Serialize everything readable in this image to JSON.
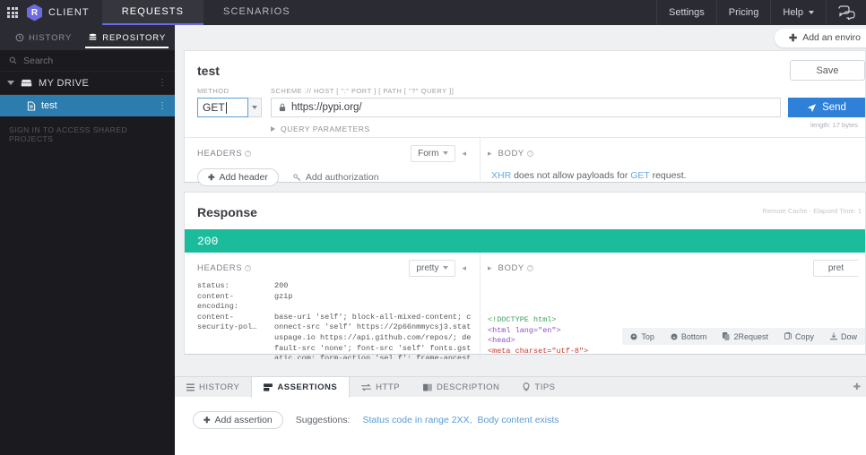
{
  "topbar": {
    "grid_icon": "apps-grid-icon",
    "logo_letter": "R",
    "brand": "CLIENT",
    "tabs": [
      {
        "label": "REQUESTS",
        "active": true
      },
      {
        "label": "SCENARIOS",
        "active": false
      }
    ],
    "right_links": [
      "Settings",
      "Pricing"
    ],
    "help_label": "Help",
    "chat_icon": "chat-bubbles-icon"
  },
  "sidebar": {
    "tabs": [
      {
        "label": "HISTORY",
        "icon": "clock-icon",
        "active": false
      },
      {
        "label": "REPOSITORY",
        "icon": "database-icon",
        "active": true
      }
    ],
    "doc_button_icon": "document-icon",
    "search_placeholder": "Search",
    "search_icon": "search-icon",
    "drive": {
      "label": "MY DRIVE",
      "icon": "drive-icon",
      "expanded": true,
      "menu": "⋮"
    },
    "files": [
      {
        "label": "test",
        "icon": "file-icon",
        "selected": true,
        "menu": "⋮"
      }
    ],
    "signin_note": "SIGN IN TO ACCESS SHARED PROJECTS"
  },
  "main": {
    "env_button": {
      "label": "Add an enviro",
      "icon": "plus-icon"
    },
    "request": {
      "title": "test",
      "save_label": "Save",
      "method_label": "METHOD",
      "method_value": "GET",
      "url_label": "SCHEME :// HOST [ \":\" PORT ] [ PATH [ \"?\" QUERY ]]",
      "url_value": "https://pypi.org/",
      "lock_icon": "lock-icon",
      "send_label": "Send",
      "send_icon": "send-icon",
      "query_params_label": "QUERY PARAMETERS",
      "length_note": "length: 17 bytes",
      "headers": {
        "title": "HEADERS",
        "form_label": "Form",
        "add_header_label": "Add header",
        "add_auth_label": "Add authorization",
        "add_icon": "plus-icon",
        "key_icon": "key-icon"
      },
      "body": {
        "title": "BODY",
        "note_prefix": "XHR",
        "note_mid": " does not allow payloads for ",
        "note_method": "GET",
        "note_suffix": " request."
      }
    },
    "response": {
      "title": "Response",
      "meta": "Remote Cache - Elapsed Time: 1",
      "status_code": "200",
      "status_color": "#1abc9c",
      "headers": {
        "title": "HEADERS",
        "pretty_label": "pretty",
        "rows": [
          {
            "key": "status:",
            "value": "200"
          },
          {
            "key": "content-encoding:",
            "value": "gzip"
          },
          {
            "key": "content-security-pol…",
            "value": "base-uri 'self'; block-all-mixed-content; connect-src 'self' https://2p66nmmycsj3.statuspage.io https://api.github.com/repos/; default-src 'none'; font-src 'self' fonts.gstatic.com; form-action 'sel f'; frame-ancestors 'none'; frame-src 'none'; img-src 'self' https://warehouse-camo.cmh1.psfhosted.o"
          }
        ]
      },
      "body": {
        "title": "BODY",
        "pretty_label": "pret",
        "code_lines": [
          "<!DOCTYPE html>",
          "<html lang=\"en\">",
          "  <head>",
          "    <meta charset=\"utf-8\">"
        ],
        "tools": [
          {
            "label": "Top",
            "icon": "arrow-up-circle-icon"
          },
          {
            "label": "Bottom",
            "icon": "arrow-down-circle-icon"
          },
          {
            "label": "2Request",
            "icon": "copy-icon"
          },
          {
            "label": "Copy",
            "icon": "clipboard-icon"
          },
          {
            "label": "Dow",
            "icon": "download-icon"
          }
        ]
      }
    }
  },
  "bottom": {
    "tabs": [
      {
        "label": "HISTORY",
        "icon": "list-icon",
        "active": false
      },
      {
        "label": "ASSERTIONS",
        "icon": "assertions-icon",
        "active": true
      },
      {
        "label": "HTTP",
        "icon": "exchange-icon",
        "active": false
      },
      {
        "label": "DESCRIPTION",
        "icon": "book-icon",
        "active": false
      },
      {
        "label": "TIPS",
        "icon": "bulb-icon",
        "active": false
      }
    ],
    "plus_icon": "plus-icon",
    "add_assertion_label": "Add assertion",
    "suggestions_label": "Suggestions:",
    "suggestions": [
      "Status code in range 2XX,",
      "Body content exists"
    ]
  }
}
